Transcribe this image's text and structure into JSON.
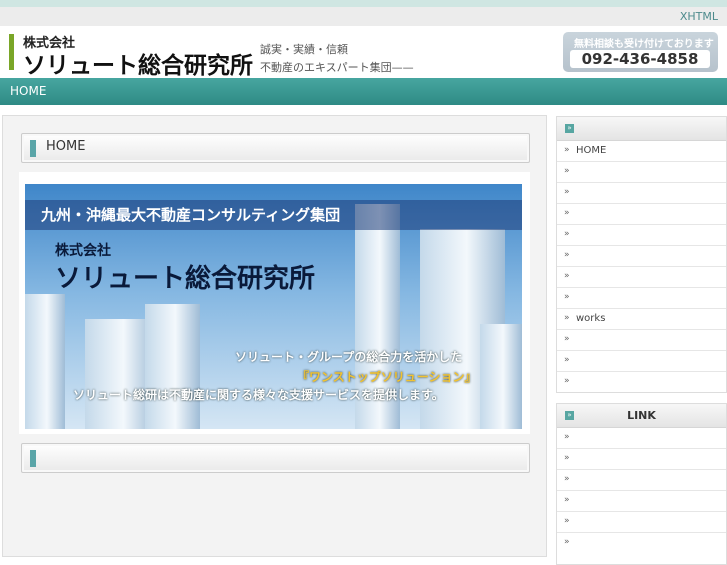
{
  "topbar": {
    "xhtml_link": "XHTML"
  },
  "header": {
    "logo_small": "株式会社",
    "logo_big": "ソリュート総合研究所",
    "tagline1": "誠実・実績・信頼",
    "tagline2": "不動産のエキスパート集団——",
    "contact_label": "無料相談も受け付けております",
    "contact_phone": "092-436-4858"
  },
  "nav": {
    "home": "HOME"
  },
  "main": {
    "panel1_title": "HOME",
    "panel2_title": "",
    "hero": {
      "banner": "九州・沖縄最大不動産コンサルティング集団",
      "company_small": "株式会社",
      "company_big": "ソリュート総合研究所",
      "line1": "ソリュート・グループの総合力を活かした",
      "line2": "『ワンストップソリューション』",
      "line3": "ソリュート総研は不動産に関する様々な支援サービスを提供します。"
    }
  },
  "sidebar": {
    "menu_title": "",
    "menu_items": [
      "HOME",
      "",
      "",
      "",
      "",
      "",
      "",
      "",
      "works",
      "",
      "",
      ""
    ],
    "link_title": "LINK",
    "link_items": [
      "",
      "",
      "",
      "",
      "",
      ""
    ],
    "arrow_glyph": "»",
    "head_icon": "»"
  }
}
